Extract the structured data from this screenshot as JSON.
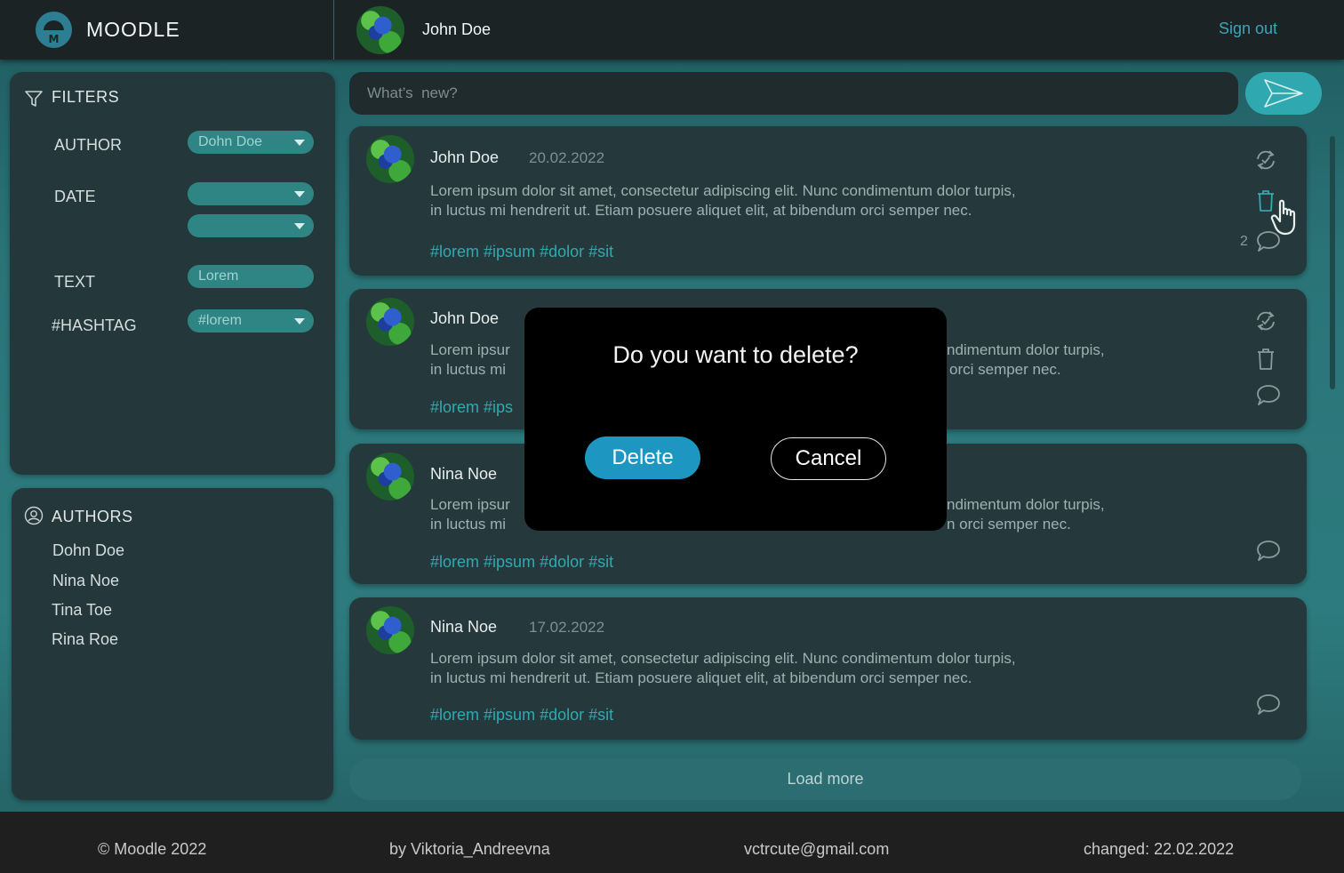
{
  "header": {
    "logo_text": "MOODLE",
    "logo_letter": "M",
    "username": "John Doe",
    "signout_label": "Sign out"
  },
  "filters": {
    "title": "FILTERS",
    "author_label": "AUTHOR",
    "author_value": "Dohn Doe",
    "date_label": "DATE",
    "date_from": "",
    "date_to": "",
    "text_label": "TEXT",
    "text_value": "Lorem",
    "hashtag_label": "#HASHTAG",
    "hashtag_value": "#lorem"
  },
  "authors": {
    "title": "AUTHORS",
    "items": [
      "Dohn Doe",
      "Nina Noe",
      "Tina Toe",
      "Rina Roe"
    ]
  },
  "compose": {
    "placeholder": "What’s  new?"
  },
  "posts": [
    {
      "author": "John Doe",
      "date": "20.02.2022",
      "text_line1": "Lorem ipsum dolor sit amet, consectetur adipiscing elit. Nunc condimentum dolor turpis,",
      "text_line2": "in luctus mi hendrerit ut. Etiam posuere aliquet elit, at bibendum orci semper nec.",
      "tags": [
        "#lorem",
        "#ipsum",
        "#dolor",
        "#sit"
      ],
      "comment_count": "2"
    },
    {
      "author": "John Doe",
      "text_line1_left": "Lorem ipsur",
      "text_line1_right": "ndimentum dolor turpis,",
      "text_line2_left": "in luctus mi",
      "text_line2_right": "orci semper nec.",
      "tags_partial": [
        "#lorem",
        "#ips"
      ]
    },
    {
      "author": "Nina Noe",
      "text_line1_left": "Lorem ipsur",
      "text_line1_right": "ndimentum dolor turpis,",
      "text_line2_left": "in luctus mi",
      "text_line2_right": "n orci semper nec.",
      "tags": [
        "#lorem",
        "#ipsum",
        "#dolor",
        "#sit"
      ]
    },
    {
      "author": "Nina Noe",
      "date": "17.02.2022",
      "text_line1": "Lorem ipsum dolor sit amet, consectetur adipiscing elit. Nunc condimentum dolor turpis,",
      "text_line2": "in luctus mi hendrerit ut. Etiam posuere aliquet elit, at bibendum orci semper nec.",
      "tags": [
        "#lorem",
        "#ipsum",
        "#dolor",
        "#sit"
      ]
    }
  ],
  "load_more_label": "Load more",
  "footer": {
    "copyright": "© Moodle 2022",
    "author": "by Viktoria_Andreevna",
    "email": "vctrcute@gmail.com",
    "changed": "changed: 22.02.2022"
  },
  "modal": {
    "title": "Do you want to delete?",
    "delete_label": "Delete",
    "cancel_label": "Cancel"
  },
  "colors": {
    "accent": "#30a8b0",
    "delete_button": "#1d97c2",
    "hashtag": "#2eaab0",
    "signout": "#3fa3b8"
  },
  "icons": [
    "filter-icon",
    "user-circle-icon",
    "send-icon",
    "repost-icon",
    "trash-icon",
    "comment-icon",
    "pointer-hand-icon"
  ]
}
